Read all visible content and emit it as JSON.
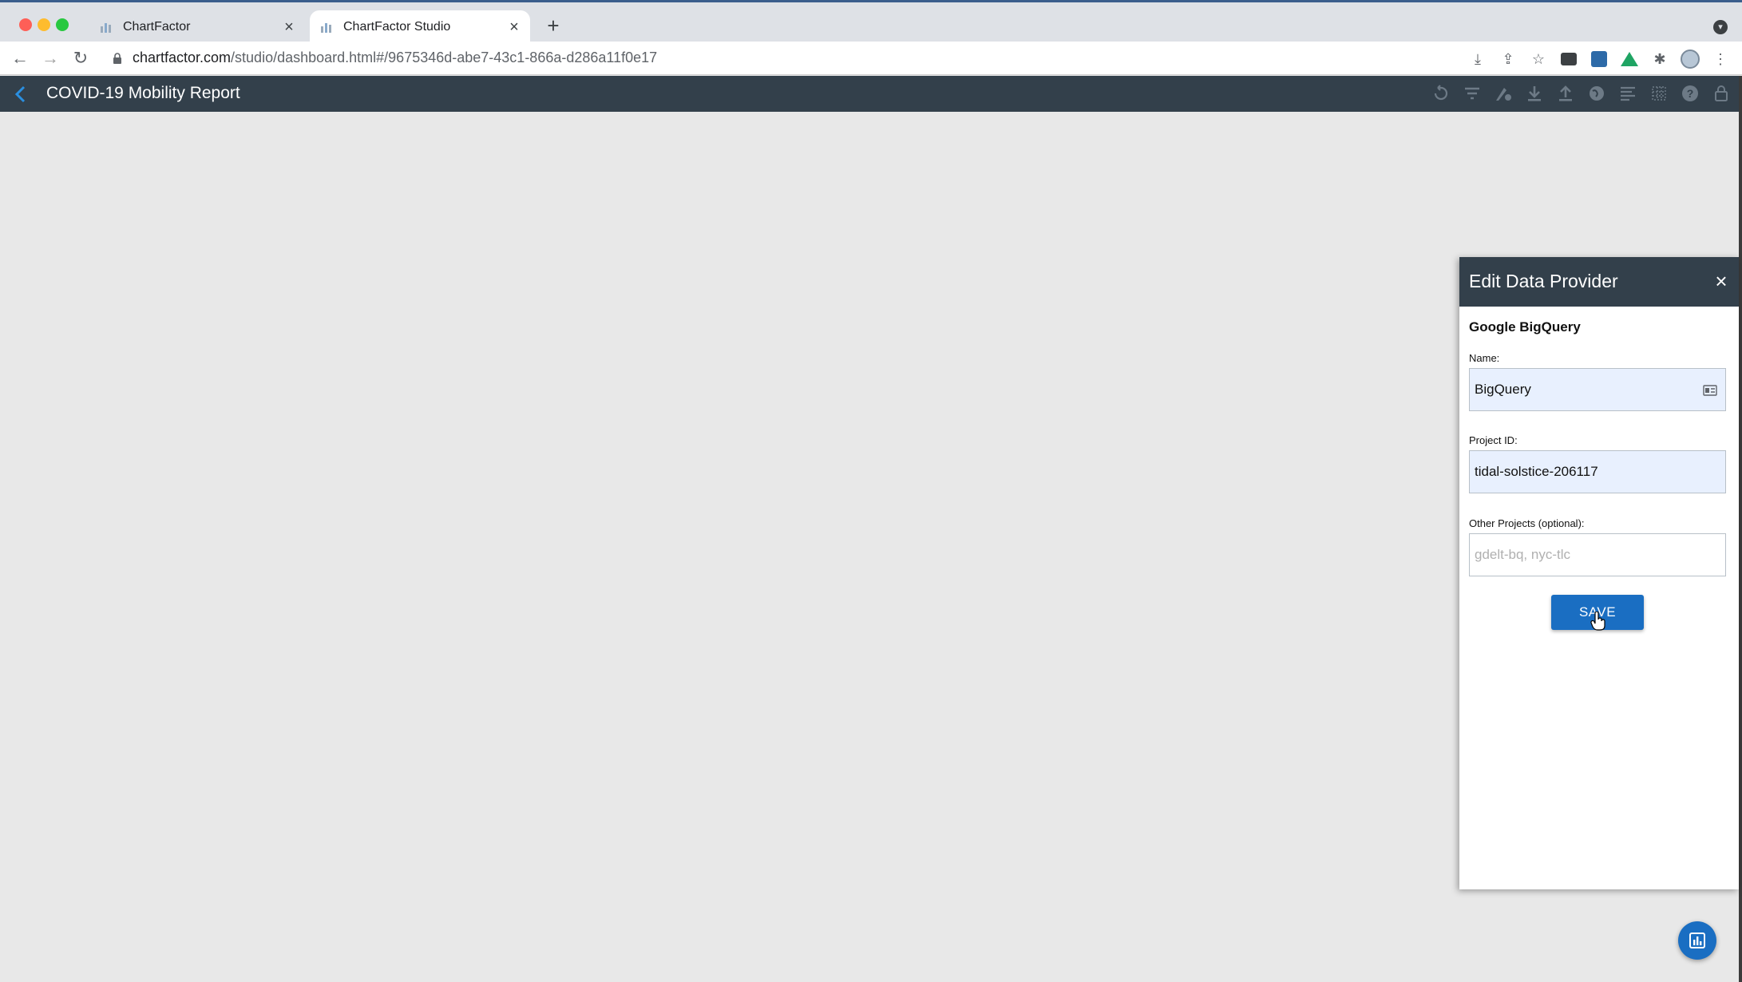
{
  "browser": {
    "tabs": [
      {
        "title": "ChartFactor",
        "active": false
      },
      {
        "title": "ChartFactor Studio",
        "active": true
      }
    ],
    "url_host": "chartfactor.com",
    "url_path": "/studio/dashboard.html#/9675346d-abe7-43c1-866a-d286a11f0e17",
    "toolbar_icons": [
      "install-icon",
      "share-icon",
      "star-icon",
      "extension-box-icon",
      "extension-blue-icon",
      "google-drive-icon",
      "puzzle-icon",
      "profile-avatar",
      "menu-dots-icon"
    ]
  },
  "app": {
    "title": "COVID-19 Mobility Report",
    "header_actions": [
      "undo-icon",
      "filter-icon",
      "theme-settings-icon",
      "download-icon",
      "upload-icon",
      "globe-icon",
      "align-icon",
      "grid-icon",
      "help-icon",
      "lock-icon"
    ]
  },
  "panel": {
    "title": "Edit Data Provider",
    "provider": "Google BigQuery",
    "name_label": "Name:",
    "name_value": "BigQuery",
    "project_label": "Project ID:",
    "project_value": "tidal-solstice-206117",
    "other_label": "Other Projects (optional):",
    "other_placeholder": "gdelt-bq, nyc-tlc",
    "save_label": "SAVE"
  },
  "colors": {
    "header_bg": "#33404b",
    "accent": "#1a6ec2",
    "canvas_bg": "#e8e8e8"
  }
}
